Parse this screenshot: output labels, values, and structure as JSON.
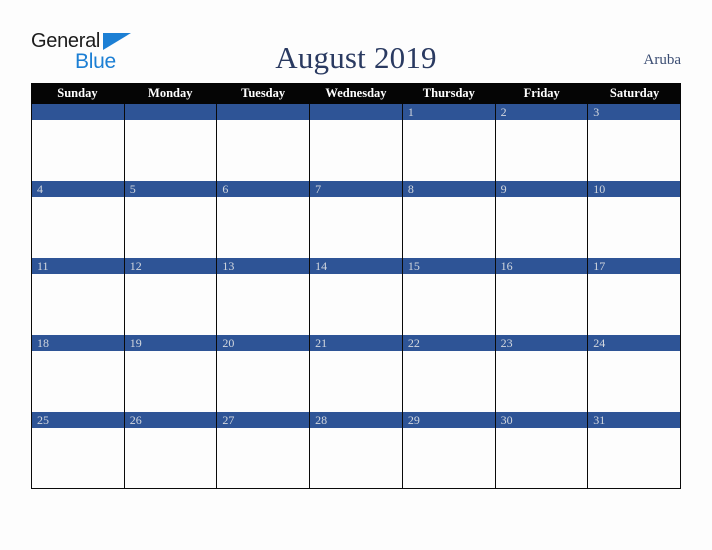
{
  "brand": {
    "logo_word_1": "General",
    "logo_word_2": "Blue",
    "logo_triangle_icon": "triangle-icon",
    "brand_color": "#1c7fd4"
  },
  "header": {
    "title": "August 2019",
    "locale": "Aruba"
  },
  "calendar": {
    "month": "August",
    "year": "2019",
    "accent_color": "#2e5496",
    "header_bg_color": "#050505",
    "day_number_color": "#d2d7de",
    "weekdays": [
      "Sunday",
      "Monday",
      "Tuesday",
      "Wednesday",
      "Thursday",
      "Friday",
      "Saturday"
    ],
    "weeks": [
      [
        {
          "date": ""
        },
        {
          "date": ""
        },
        {
          "date": ""
        },
        {
          "date": ""
        },
        {
          "date": "1"
        },
        {
          "date": "2"
        },
        {
          "date": "3"
        }
      ],
      [
        {
          "date": "4"
        },
        {
          "date": "5"
        },
        {
          "date": "6"
        },
        {
          "date": "7"
        },
        {
          "date": "8"
        },
        {
          "date": "9"
        },
        {
          "date": "10"
        }
      ],
      [
        {
          "date": "11"
        },
        {
          "date": "12"
        },
        {
          "date": "13"
        },
        {
          "date": "14"
        },
        {
          "date": "15"
        },
        {
          "date": "16"
        },
        {
          "date": "17"
        }
      ],
      [
        {
          "date": "18"
        },
        {
          "date": "19"
        },
        {
          "date": "20"
        },
        {
          "date": "21"
        },
        {
          "date": "22"
        },
        {
          "date": "23"
        },
        {
          "date": "24"
        }
      ],
      [
        {
          "date": "25"
        },
        {
          "date": "26"
        },
        {
          "date": "27"
        },
        {
          "date": "28"
        },
        {
          "date": "29"
        },
        {
          "date": "30"
        },
        {
          "date": "31"
        }
      ]
    ]
  }
}
